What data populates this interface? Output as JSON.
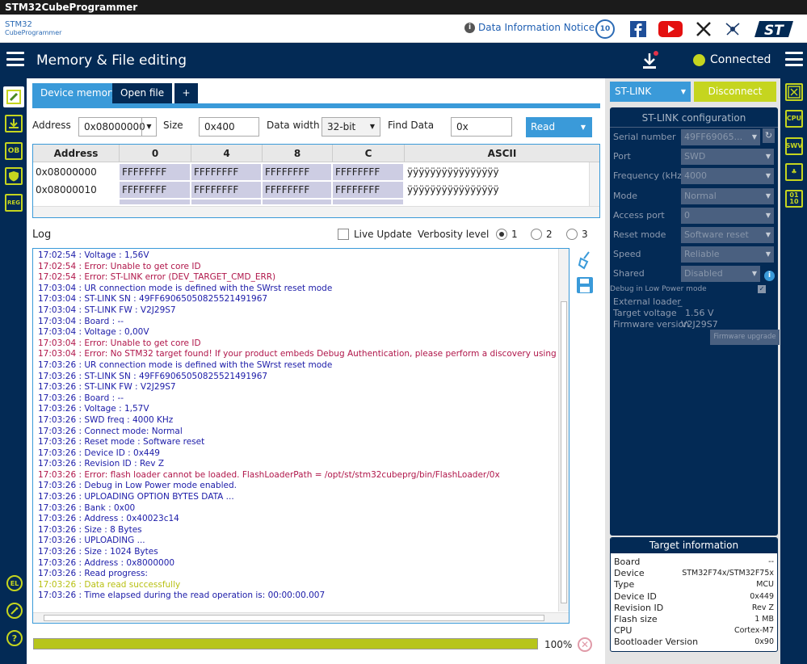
{
  "window": {
    "title": "STM32CubeProgrammer"
  },
  "brand": {
    "logo_top": "STM32",
    "logo_bottom": "CubeProgrammer",
    "notice": "Data Information Notice",
    "badge": "10"
  },
  "header": {
    "title": "Memory & File editing",
    "status": "Connected"
  },
  "tabs": [
    {
      "label": "Device memory"
    },
    {
      "label": "Open file"
    },
    {
      "label": "+"
    }
  ],
  "memory": {
    "address_label": "Address",
    "address_value": "0x08000000",
    "size_label": "Size",
    "size_value": "0x400",
    "data_width_label": "Data width",
    "data_width_value": "32-bit",
    "find_label": "Find Data",
    "find_value": "0x",
    "read_label": "Read"
  },
  "grid": {
    "headers": [
      "Address",
      "0",
      "4",
      "8",
      "C",
      "ASCII"
    ],
    "rows": [
      {
        "addr": "0x08000000",
        "c0": "FFFFFFFF",
        "c4": "FFFFFFFF",
        "c8": "FFFFFFFF",
        "cc": "FFFFFFFF",
        "ascii": "ÿÿÿÿÿÿÿÿÿÿÿÿÿÿÿÿ"
      },
      {
        "addr": "0x08000010",
        "c0": "FFFFFFFF",
        "c4": "FFFFFFFF",
        "c8": "FFFFFFFF",
        "cc": "FFFFFFFF",
        "ascii": "ÿÿÿÿÿÿÿÿÿÿÿÿÿÿÿÿ"
      }
    ]
  },
  "log": {
    "label": "Log",
    "live_update": "Live Update",
    "verbosity_label": "Verbosity level",
    "levels": [
      "1",
      "2",
      "3"
    ],
    "selected_level": "1",
    "lines": [
      {
        "t": "17:02:54 : Voltage     : 1,56V",
        "c": "blue"
      },
      {
        "t": "17:02:54 : Error: Unable to get core ID",
        "c": "red"
      },
      {
        "t": "17:02:54 : Error: ST-LINK error (DEV_TARGET_CMD_ERR)",
        "c": "red"
      },
      {
        "t": "17:03:04 : UR connection mode is defined with the SWrst reset mode",
        "c": "blue"
      },
      {
        "t": "17:03:04 : ST-LINK SN  : 49FF69065050825521491967",
        "c": "blue"
      },
      {
        "t": "17:03:04 : ST-LINK FW  : V2J29S7",
        "c": "blue"
      },
      {
        "t": "17:03:04 : Board       : --",
        "c": "blue"
      },
      {
        "t": "17:03:04 : Voltage     : 0,00V",
        "c": "blue"
      },
      {
        "t": "17:03:04 : Error: Unable to get core ID",
        "c": "red"
      },
      {
        "t": "17:03:04 : Error: No STM32 target found! If your product embeds Debug Authentication, please perform a discovery using Debug Authent",
        "c": "red"
      },
      {
        "t": "17:03:26 : UR connection mode is defined with the SWrst reset mode",
        "c": "blue"
      },
      {
        "t": "17:03:26 : ST-LINK SN  : 49FF69065050825521491967",
        "c": "blue"
      },
      {
        "t": "17:03:26 : ST-LINK FW  : V2J29S7",
        "c": "blue"
      },
      {
        "t": "17:03:26 : Board       : --",
        "c": "blue"
      },
      {
        "t": "17:03:26 : Voltage     : 1,57V",
        "c": "blue"
      },
      {
        "t": "17:03:26 : SWD freq    : 4000 KHz",
        "c": "blue"
      },
      {
        "t": "17:03:26 : Connect mode: Normal",
        "c": "blue"
      },
      {
        "t": "17:03:26 : Reset mode  : Software reset",
        "c": "blue"
      },
      {
        "t": "17:03:26 : Device ID   : 0x449",
        "c": "blue"
      },
      {
        "t": "17:03:26 : Revision ID : Rev Z",
        "c": "blue"
      },
      {
        "t": "17:03:26 : Error: flash loader cannot be loaded. FlashLoaderPath = /opt/st/stm32cubeprg/bin/FlashLoader/0x",
        "c": "red"
      },
      {
        "t": "17:03:26 : Debug in Low Power mode enabled.",
        "c": "blue"
      },
      {
        "t": "17:03:26 : UPLOADING OPTION BYTES DATA ...",
        "c": "blue"
      },
      {
        "t": "17:03:26 :   Bank          : 0x00",
        "c": "blue"
      },
      {
        "t": "17:03:26 :   Address       : 0x40023c14",
        "c": "blue"
      },
      {
        "t": "17:03:26 :   Size          : 8 Bytes",
        "c": "blue"
      },
      {
        "t": "17:03:26 : UPLOADING ...",
        "c": "blue"
      },
      {
        "t": "17:03:26 :   Size          : 1024 Bytes",
        "c": "blue"
      },
      {
        "t": "17:03:26 :   Address       : 0x8000000",
        "c": "blue"
      },
      {
        "t": "17:03:26 : Read progress:",
        "c": "blue"
      },
      {
        "t": "17:03:26 : Data read successfully",
        "c": "yellow"
      },
      {
        "t": "17:03:26 : Time elapsed during the read operation is: 00:00:00.007",
        "c": "blue"
      }
    ]
  },
  "progress": {
    "value": 100,
    "label": "100%"
  },
  "stlink": {
    "dropdown": "ST-LINK",
    "disconnect": "Disconnect",
    "config_title": "ST-LINK configuration",
    "fields": [
      {
        "label": "Serial number",
        "value": "49FF69065..."
      },
      {
        "label": "Port",
        "value": "SWD"
      },
      {
        "label": "Frequency (kHz)",
        "value": "4000"
      },
      {
        "label": "Mode",
        "value": "Normal"
      },
      {
        "label": "Access port",
        "value": "0"
      },
      {
        "label": "Reset mode",
        "value": "Software reset"
      },
      {
        "label": "Speed",
        "value": "Reliable"
      },
      {
        "label": "Shared",
        "value": "Disabled"
      }
    ],
    "debug_low_power": "Debug in Low Power mode",
    "external_loader_label": "External loader",
    "external_loader_value": "_",
    "target_voltage_label": "Target voltage",
    "target_voltage_value": "1.56 V",
    "firmware_label": "Firmware version",
    "firmware_value": "V2J29S7",
    "firmware_upgrade": "Firmware upgrade"
  },
  "target": {
    "title": "Target information",
    "rows": [
      {
        "k": "Board",
        "v": "--"
      },
      {
        "k": "Device",
        "v": "STM32F74x/STM32F75x"
      },
      {
        "k": "Type",
        "v": "MCU"
      },
      {
        "k": "Device ID",
        "v": "0x449"
      },
      {
        "k": "Revision ID",
        "v": "Rev Z"
      },
      {
        "k": "Flash size",
        "v": "1 MB"
      },
      {
        "k": "CPU",
        "v": "Cortex-M7"
      },
      {
        "k": "Bootloader Version",
        "v": "0x90"
      }
    ]
  },
  "leftbar": {
    "ob": "OB",
    "reg": "REG",
    "el": "EL",
    "help": "?"
  },
  "rightbar": {
    "cpu": "CPU",
    "swv": "SWV",
    "bin": "01 10"
  },
  "colors": {
    "navy": "#032a55",
    "accent": "#3a9ad9",
    "lime": "#c5d51f"
  }
}
